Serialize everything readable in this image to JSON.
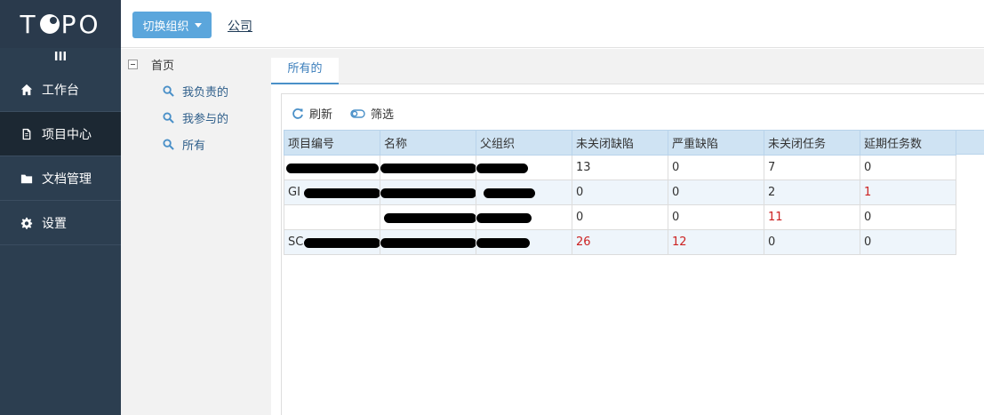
{
  "sidebar": {
    "logo": "TOPO",
    "collapse_glyph": "III",
    "items": [
      {
        "label": "工作台",
        "icon": "home-icon"
      },
      {
        "label": "项目中心",
        "icon": "document-icon"
      },
      {
        "label": "文档管理",
        "icon": "folder-icon"
      },
      {
        "label": "设置",
        "icon": "gear-icon"
      }
    ]
  },
  "topbar": {
    "switch_label": "切换组织",
    "company_link": "公司"
  },
  "tree": {
    "root": "首页",
    "children": [
      "我负责的",
      "我参与的",
      "所有"
    ]
  },
  "tabs": {
    "active": "所有的"
  },
  "toolbar": {
    "refresh": "刷新",
    "filter": "筛选"
  },
  "table": {
    "headers": [
      "项目编号",
      "名称",
      "父组织",
      "未关闭缺陷",
      "严重缺陷",
      "未关闭任务",
      "延期任务数"
    ],
    "rows": [
      {
        "code": "",
        "name": "",
        "parent": "",
        "open_bugs": "13",
        "severe": "0",
        "open_tasks": "7",
        "delayed": "0"
      },
      {
        "code": "GI",
        "name": "",
        "parent": "",
        "open_bugs": "0",
        "severe": "0",
        "open_tasks": "2",
        "delayed": "1"
      },
      {
        "code": "",
        "name": "",
        "parent": "",
        "open_bugs": "0",
        "severe": "0",
        "open_tasks": "11",
        "delayed": "0"
      },
      {
        "code": "SC",
        "name": "",
        "parent": "",
        "open_bugs": "26",
        "severe": "12",
        "open_tasks": "0",
        "delayed": "0"
      }
    ]
  },
  "colors": {
    "sidebar_bg": "#2c3e50",
    "accent": "#5ba6dc",
    "header_bg": "#cfe3f3",
    "alert_red": "#cc2222"
  }
}
